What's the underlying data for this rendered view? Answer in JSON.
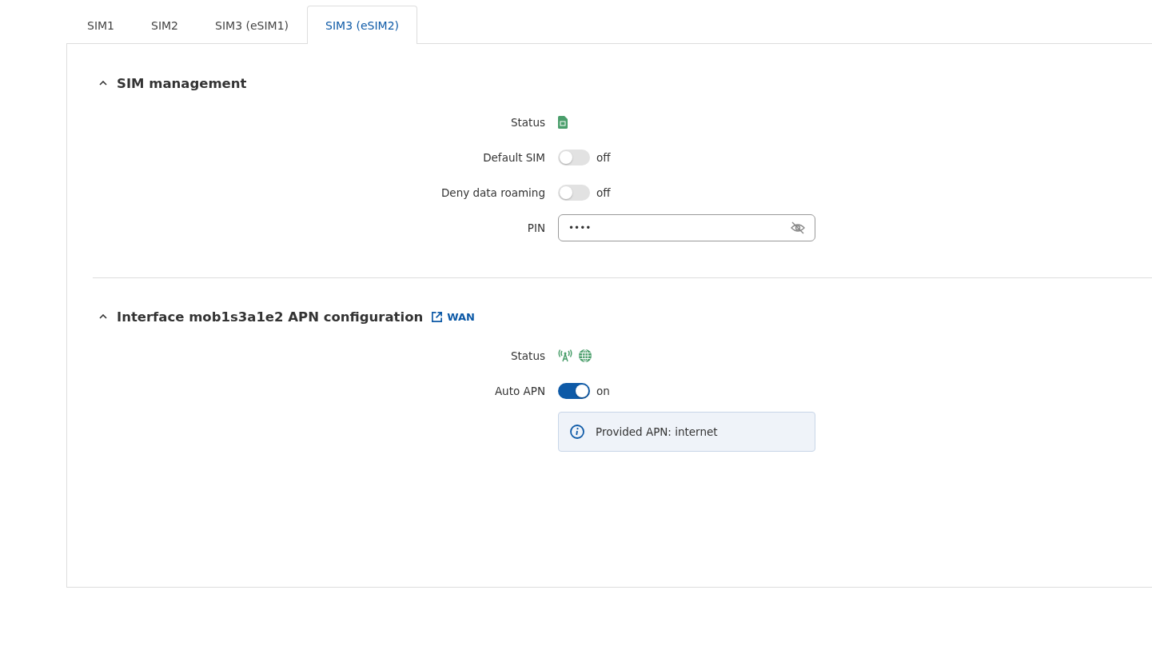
{
  "tabs": [
    {
      "label": "SIM1",
      "selected": false
    },
    {
      "label": "SIM2",
      "selected": false
    },
    {
      "label": "SIM3 (eSIM1)",
      "selected": false
    },
    {
      "label": "SIM3 (eSIM2)",
      "selected": true
    }
  ],
  "sections": [
    {
      "title": "SIM management",
      "expanded": true,
      "rows": [
        {
          "kind": "sim_status",
          "label": "Status"
        },
        {
          "kind": "toggle",
          "label": "Default SIM",
          "on": false,
          "reading": "off"
        },
        {
          "kind": "toggle",
          "label": "Deny data roaming",
          "on": false,
          "reading": "off"
        },
        {
          "kind": "password",
          "label": "PIN",
          "value": "••••"
        }
      ]
    },
    {
      "title": "Interface mob1s3a1e2 APN configuration",
      "expanded": true,
      "link": "WAN",
      "rows": [
        {
          "kind": "connection_status",
          "label": "Status"
        },
        {
          "kind": "toggle",
          "label": "Auto APN",
          "on": true,
          "reading": "on"
        },
        {
          "kind": "info",
          "text": "Provided APN: internet"
        }
      ]
    }
  ]
}
